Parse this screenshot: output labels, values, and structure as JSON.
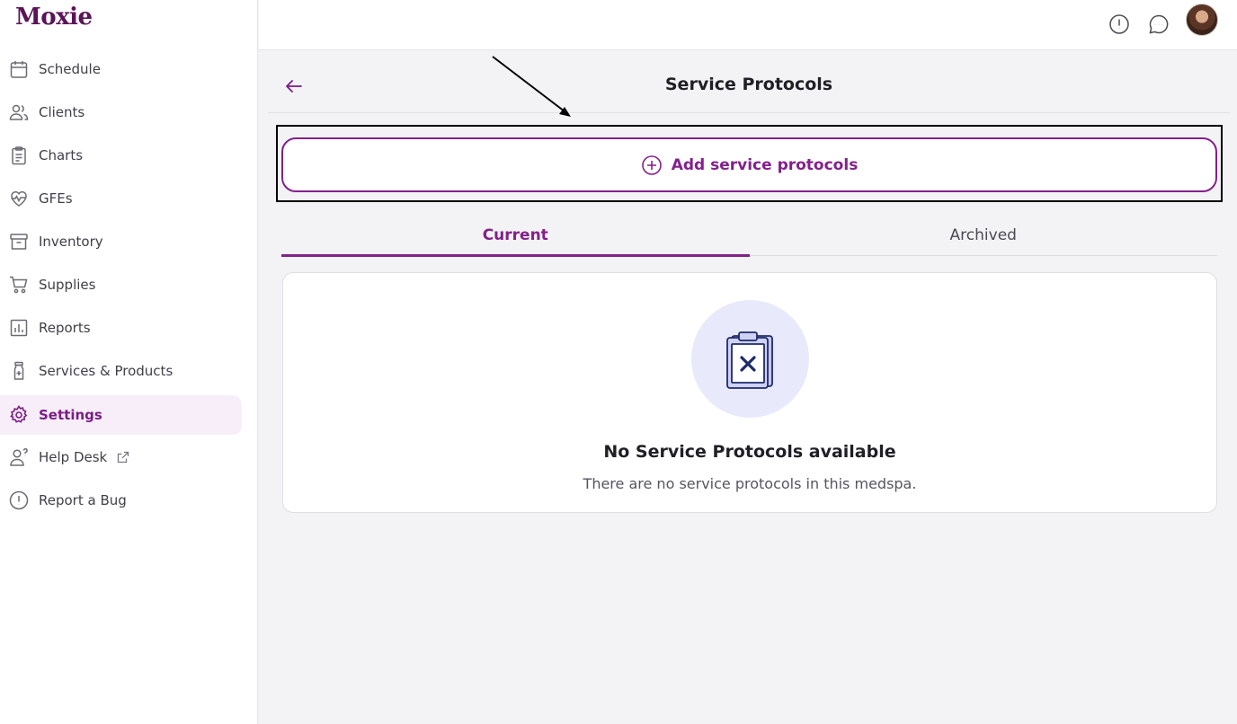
{
  "app": {
    "logo_text": "Moxie"
  },
  "sidebar": {
    "items": [
      {
        "label": "Schedule",
        "icon": "calendar-icon"
      },
      {
        "label": "Clients",
        "icon": "users-icon"
      },
      {
        "label": "Charts",
        "icon": "clipboard-icon"
      },
      {
        "label": "GFEs",
        "icon": "heart-pulse-icon"
      },
      {
        "label": "Inventory",
        "icon": "archive-box-icon"
      },
      {
        "label": "Supplies",
        "icon": "cart-icon"
      },
      {
        "label": "Reports",
        "icon": "bar-chart-icon"
      },
      {
        "label": "Services & Products",
        "icon": "vial-plus-icon"
      },
      {
        "label": "Settings",
        "icon": "gear-icon",
        "active": true
      },
      {
        "label": "Help Desk",
        "icon": "user-question-icon",
        "external": true
      },
      {
        "label": "Report a Bug",
        "icon": "alert-circle-icon"
      }
    ]
  },
  "topbar": {
    "icons": [
      "alert-circle-icon",
      "chat-bubble-icon",
      "avatar"
    ]
  },
  "header": {
    "title": "Service Protocols",
    "back_icon": "arrow-left-icon"
  },
  "actions": {
    "add_label": "Add service protocols",
    "add_icon": "plus-circle-icon"
  },
  "tabs": [
    {
      "label": "Current",
      "active": true
    },
    {
      "label": "Archived",
      "active": false
    }
  ],
  "empty_state": {
    "title": "No Service Protocols available",
    "text": "There are no service protocols in this medspa.",
    "icon": "clipboard-x-icon"
  },
  "colors": {
    "accent": "#84208c",
    "logo": "#5b1557",
    "active_bg": "#f7eefa",
    "empty_circle": "#e8e9fb",
    "empty_icon_stroke": "#1f2a6b"
  }
}
